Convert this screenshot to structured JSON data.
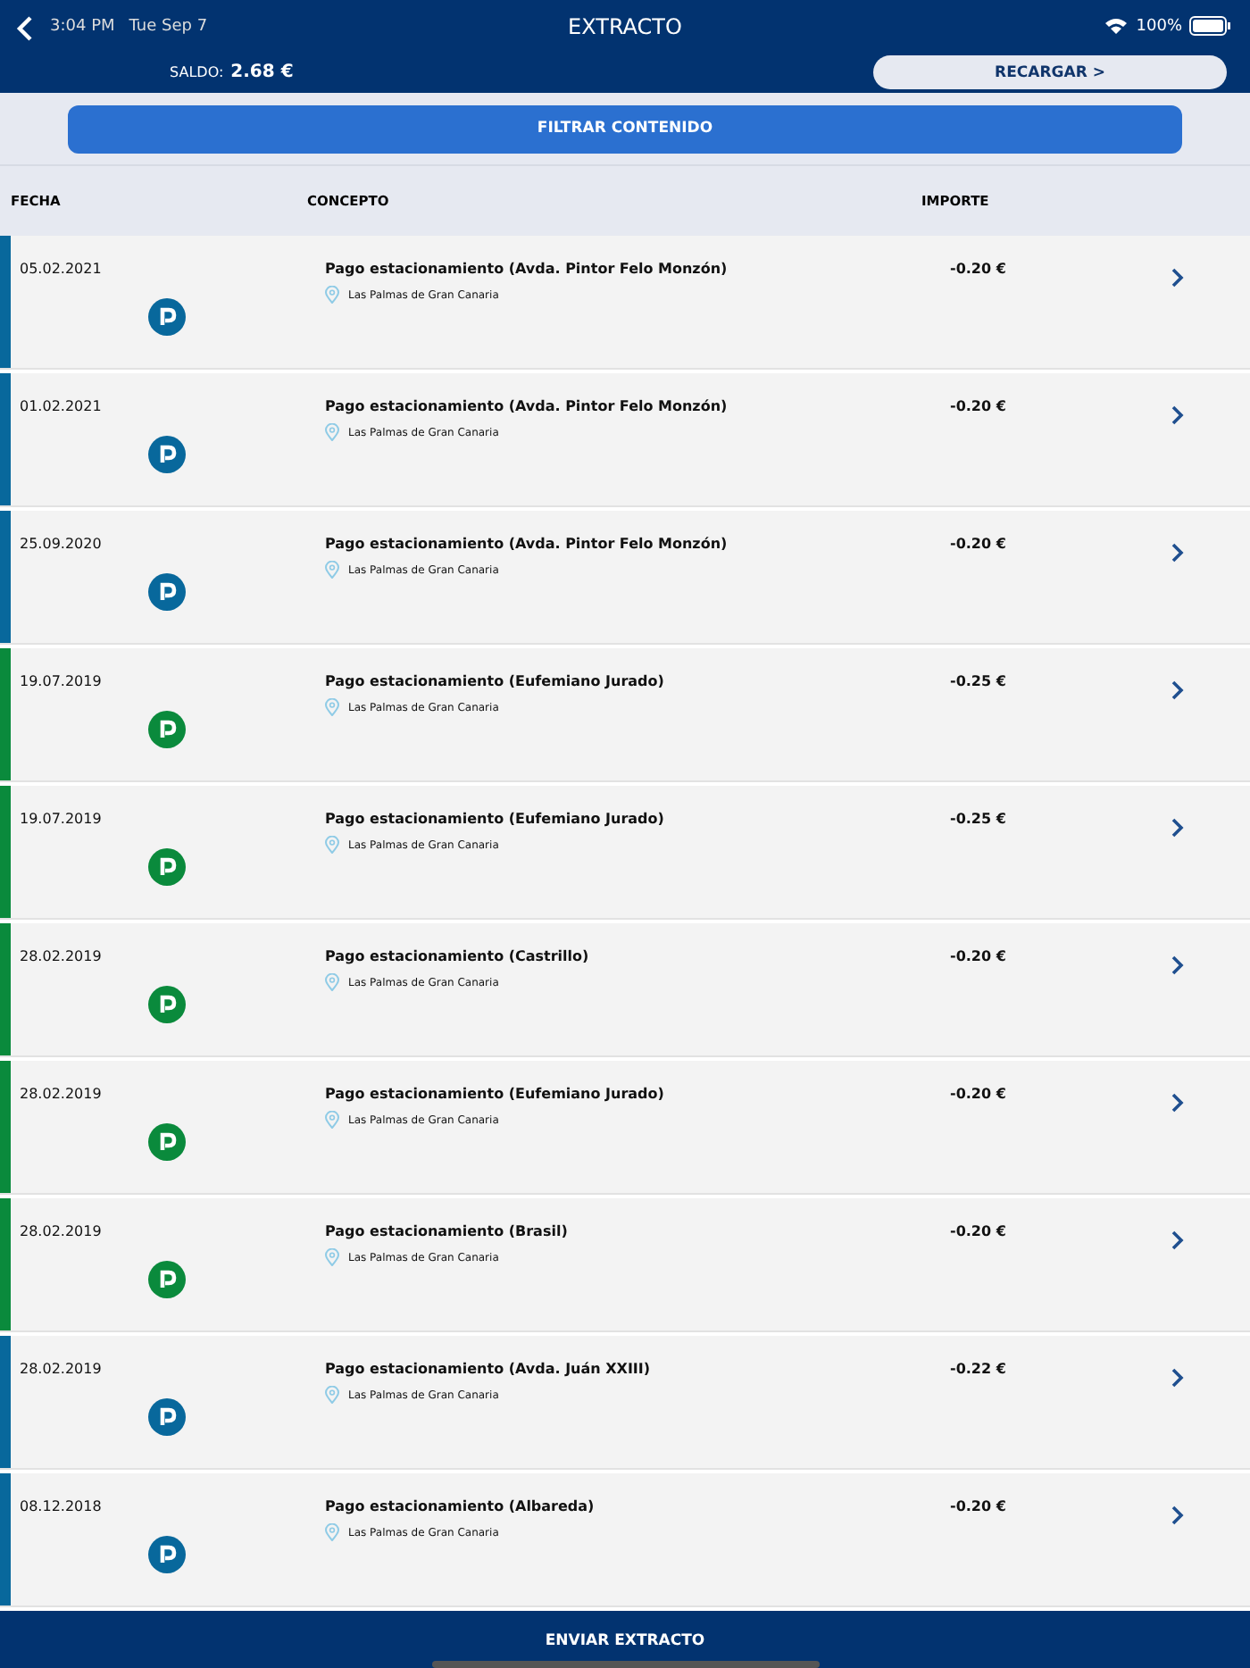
{
  "status_bar": {
    "time": "3:04 PM",
    "date": "Tue Sep 7",
    "battery": "100%"
  },
  "header": {
    "title": "EXTRACTO",
    "balance_label": "SALDO:",
    "balance": "2.68 €",
    "recharge_button": "RECARGAR >"
  },
  "filter_button": "FILTRAR CONTENIDO",
  "table": {
    "columns": [
      "FECHA",
      "CONCEPTO",
      "IMPORTE"
    ],
    "rows": [
      {
        "date": "05.02.2021",
        "concept": "Pago estacionamiento (Avda. Pintor Felo Monzón)",
        "location": "Las Palmas de Gran Canaria",
        "amount": "-0.20 €",
        "color": "#08689c"
      },
      {
        "date": "01.02.2021",
        "concept": "Pago estacionamiento (Avda. Pintor Felo Monzón)",
        "location": "Las Palmas de Gran Canaria",
        "amount": "-0.20 €",
        "color": "#08689c"
      },
      {
        "date": "25.09.2020",
        "concept": "Pago estacionamiento (Avda. Pintor Felo Monzón)",
        "location": "Las Palmas de Gran Canaria",
        "amount": "-0.20 €",
        "color": "#08689c"
      },
      {
        "date": "19.07.2019",
        "concept": "Pago estacionamiento (Eufemiano Jurado)",
        "location": "Las Palmas de Gran Canaria",
        "amount": "-0.25 €",
        "color": "#0a8a3c"
      },
      {
        "date": "19.07.2019",
        "concept": "Pago estacionamiento (Eufemiano Jurado)",
        "location": "Las Palmas de Gran Canaria",
        "amount": "-0.25 €",
        "color": "#0a8a3c"
      },
      {
        "date": "28.02.2019",
        "concept": "Pago estacionamiento (Castrillo)",
        "location": "Las Palmas de Gran Canaria",
        "amount": "-0.20 €",
        "color": "#0a8a3c"
      },
      {
        "date": "28.02.2019",
        "concept": "Pago estacionamiento (Eufemiano Jurado)",
        "location": "Las Palmas de Gran Canaria",
        "amount": "-0.20 €",
        "color": "#0a8a3c"
      },
      {
        "date": "28.02.2019",
        "concept": "Pago estacionamiento (Brasil)",
        "location": "Las Palmas de Gran Canaria",
        "amount": "-0.20 €",
        "color": "#0a8a3c"
      },
      {
        "date": "28.02.2019",
        "concept": "Pago estacionamiento (Avda. Juán XXIII)",
        "location": "Las Palmas de Gran Canaria",
        "amount": "-0.22 €",
        "color": "#08689c"
      },
      {
        "date": "08.12.2018",
        "concept": "Pago estacionamiento (Albareda)",
        "location": "Las Palmas de Gran Canaria",
        "amount": "-0.20 €",
        "color": "#08689c"
      }
    ]
  },
  "footer_button": "ENVIAR EXTRACTO"
}
